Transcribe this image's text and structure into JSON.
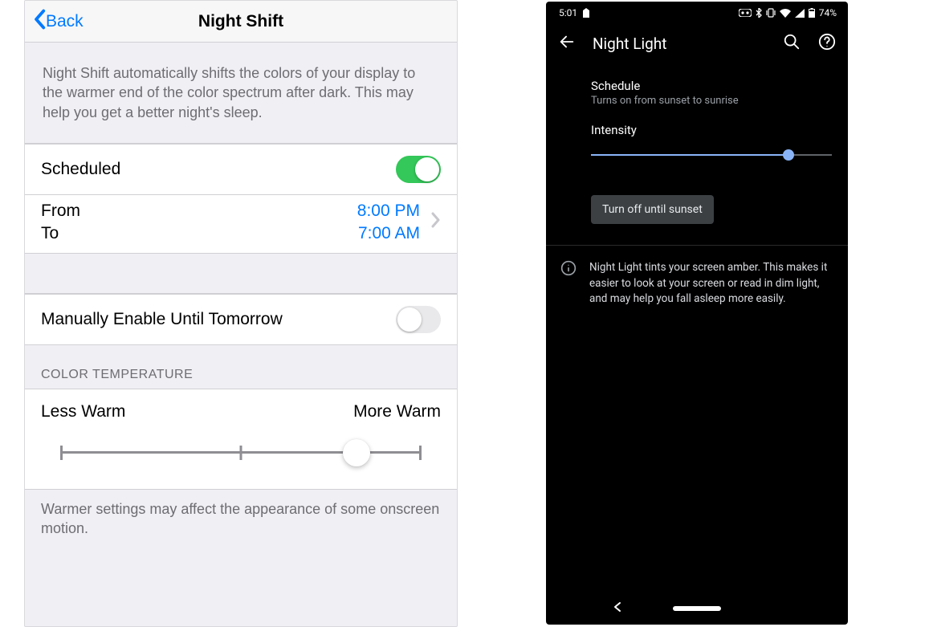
{
  "ios": {
    "back_label": "Back",
    "title": "Night Shift",
    "description": "Night Shift automatically shifts the colors of your display to the warmer end of the color spectrum after dark. This may help you get a better night's sleep.",
    "scheduled": {
      "label": "Scheduled",
      "on": true
    },
    "schedule": {
      "from_label": "From",
      "to_label": "To",
      "from_value": "8:00 PM",
      "to_value": "7:00 AM"
    },
    "manual": {
      "label": "Manually Enable Until Tomorrow",
      "on": false
    },
    "color_temp_header": "COLOR TEMPERATURE",
    "slider": {
      "less_label": "Less Warm",
      "more_label": "More Warm",
      "value_pct": 82
    },
    "footer_note": "Warmer settings may affect the appearance of some onscreen motion."
  },
  "android": {
    "status": {
      "time": "5:01",
      "battery_text": "74%"
    },
    "title": "Night Light",
    "schedule": {
      "label": "Schedule",
      "value": "Turns on from sunset to sunrise"
    },
    "intensity": {
      "label": "Intensity",
      "value_pct": 82
    },
    "toggle_button": "Turn off until sunset",
    "info_text": "Night Light tints your screen amber. This makes it easier to look at your screen or read in dim light, and may help you fall asleep more easily."
  }
}
